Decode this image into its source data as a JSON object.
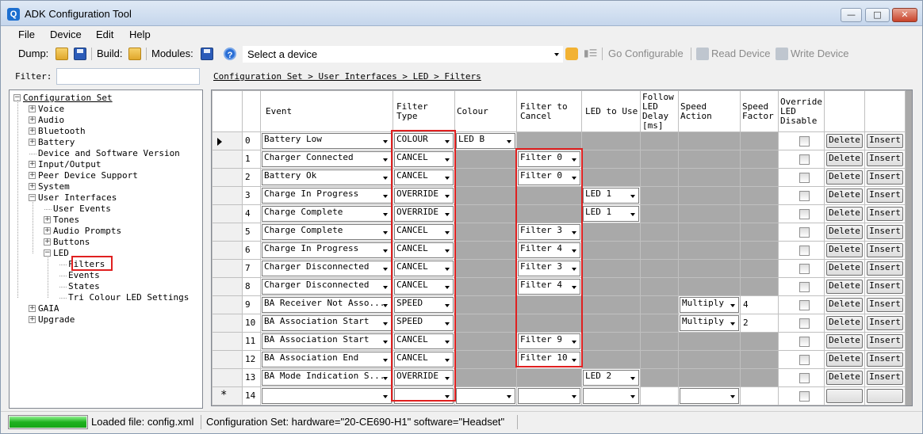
{
  "window": {
    "title": "ADK Configuration Tool",
    "icon": "Q"
  },
  "menu": [
    "File",
    "Device",
    "Edit",
    "Help"
  ],
  "toolbar": {
    "dump_label": "Dump:",
    "build_label": "Build:",
    "modules_label": "Modules:",
    "device_placeholder": "Select a device",
    "go_configurable": "Go Configurable",
    "read_device": "Read Device",
    "write_device": "Write Device"
  },
  "filter": {
    "label": "Filter:",
    "value": ""
  },
  "breadcrumb": "Configuration Set > User Interfaces > LED > Filters",
  "tree": {
    "root": "Configuration Set",
    "items": [
      "Voice",
      "Audio",
      "Bluetooth",
      "Battery",
      "Device and Software Version",
      "Input/Output",
      "Peer Device Support",
      "System",
      "User Interfaces"
    ],
    "ui_children": [
      "User Events",
      "Tones",
      "Audio Prompts",
      "Buttons",
      "LED"
    ],
    "led_children": [
      "Filters",
      "Events",
      "States",
      "Tri Colour LED Settings"
    ],
    "tail": [
      "GAIA",
      "Upgrade"
    ],
    "selected": "Filters"
  },
  "grid": {
    "columns": [
      "Event",
      "Filter Type",
      "Colour",
      "Filter to Cancel",
      "LED to Use",
      "Follow LED Delay [ms]",
      "Speed Action",
      "Speed Factor",
      "Override LED Disable"
    ],
    "delete_label": "Delete",
    "insert_label": "Insert",
    "rows": [
      {
        "n": "0",
        "event": "Battery Low",
        "type": "COLOUR",
        "colour": "LED B",
        "cancel": "",
        "led": "",
        "action": "",
        "factor": ""
      },
      {
        "n": "1",
        "event": "Charger Connected",
        "type": "CANCEL",
        "colour": "",
        "cancel": "Filter 0",
        "led": "",
        "action": "",
        "factor": ""
      },
      {
        "n": "2",
        "event": "Battery Ok",
        "type": "CANCEL",
        "colour": "",
        "cancel": "Filter 0",
        "led": "",
        "action": "",
        "factor": ""
      },
      {
        "n": "3",
        "event": "Charge In Progress",
        "type": "OVERRIDE",
        "colour": "",
        "cancel": "",
        "led": "LED 1",
        "action": "",
        "factor": ""
      },
      {
        "n": "4",
        "event": "Charge Complete",
        "type": "OVERRIDE",
        "colour": "",
        "cancel": "",
        "led": "LED 1",
        "action": "",
        "factor": ""
      },
      {
        "n": "5",
        "event": "Charge Complete",
        "type": "CANCEL",
        "colour": "",
        "cancel": "Filter 3",
        "led": "",
        "action": "",
        "factor": ""
      },
      {
        "n": "6",
        "event": "Charge In Progress",
        "type": "CANCEL",
        "colour": "",
        "cancel": "Filter 4",
        "led": "",
        "action": "",
        "factor": ""
      },
      {
        "n": "7",
        "event": "Charger Disconnected",
        "type": "CANCEL",
        "colour": "",
        "cancel": "Filter 3",
        "led": "",
        "action": "",
        "factor": ""
      },
      {
        "n": "8",
        "event": "Charger Disconnected",
        "type": "CANCEL",
        "colour": "",
        "cancel": "Filter 4",
        "led": "",
        "action": "",
        "factor": ""
      },
      {
        "n": "9",
        "event": "BA Receiver Not Asso...",
        "type": "SPEED",
        "colour": "",
        "cancel": "",
        "led": "",
        "action": "Multiply",
        "factor": "4"
      },
      {
        "n": "10",
        "event": "BA Association Start",
        "type": "SPEED",
        "colour": "",
        "cancel": "",
        "led": "",
        "action": "Multiply",
        "factor": "2"
      },
      {
        "n": "11",
        "event": "BA Association Start",
        "type": "CANCEL",
        "colour": "",
        "cancel": "Filter 9",
        "led": "",
        "action": "",
        "factor": ""
      },
      {
        "n": "12",
        "event": "BA Association End",
        "type": "CANCEL",
        "colour": "",
        "cancel": "Filter 10",
        "led": "",
        "action": "",
        "factor": ""
      },
      {
        "n": "13",
        "event": "BA Mode Indication S...",
        "type": "OVERRIDE",
        "colour": "",
        "cancel": "",
        "led": "LED 2",
        "action": "",
        "factor": ""
      }
    ],
    "new_row": {
      "n": "14",
      "marker": "*"
    }
  },
  "status": {
    "progress": 1.0,
    "loaded": "Loaded file: config.xml",
    "config": "Configuration Set:  hardware=\"20-CE690-H1\" software=\"Headset\""
  }
}
